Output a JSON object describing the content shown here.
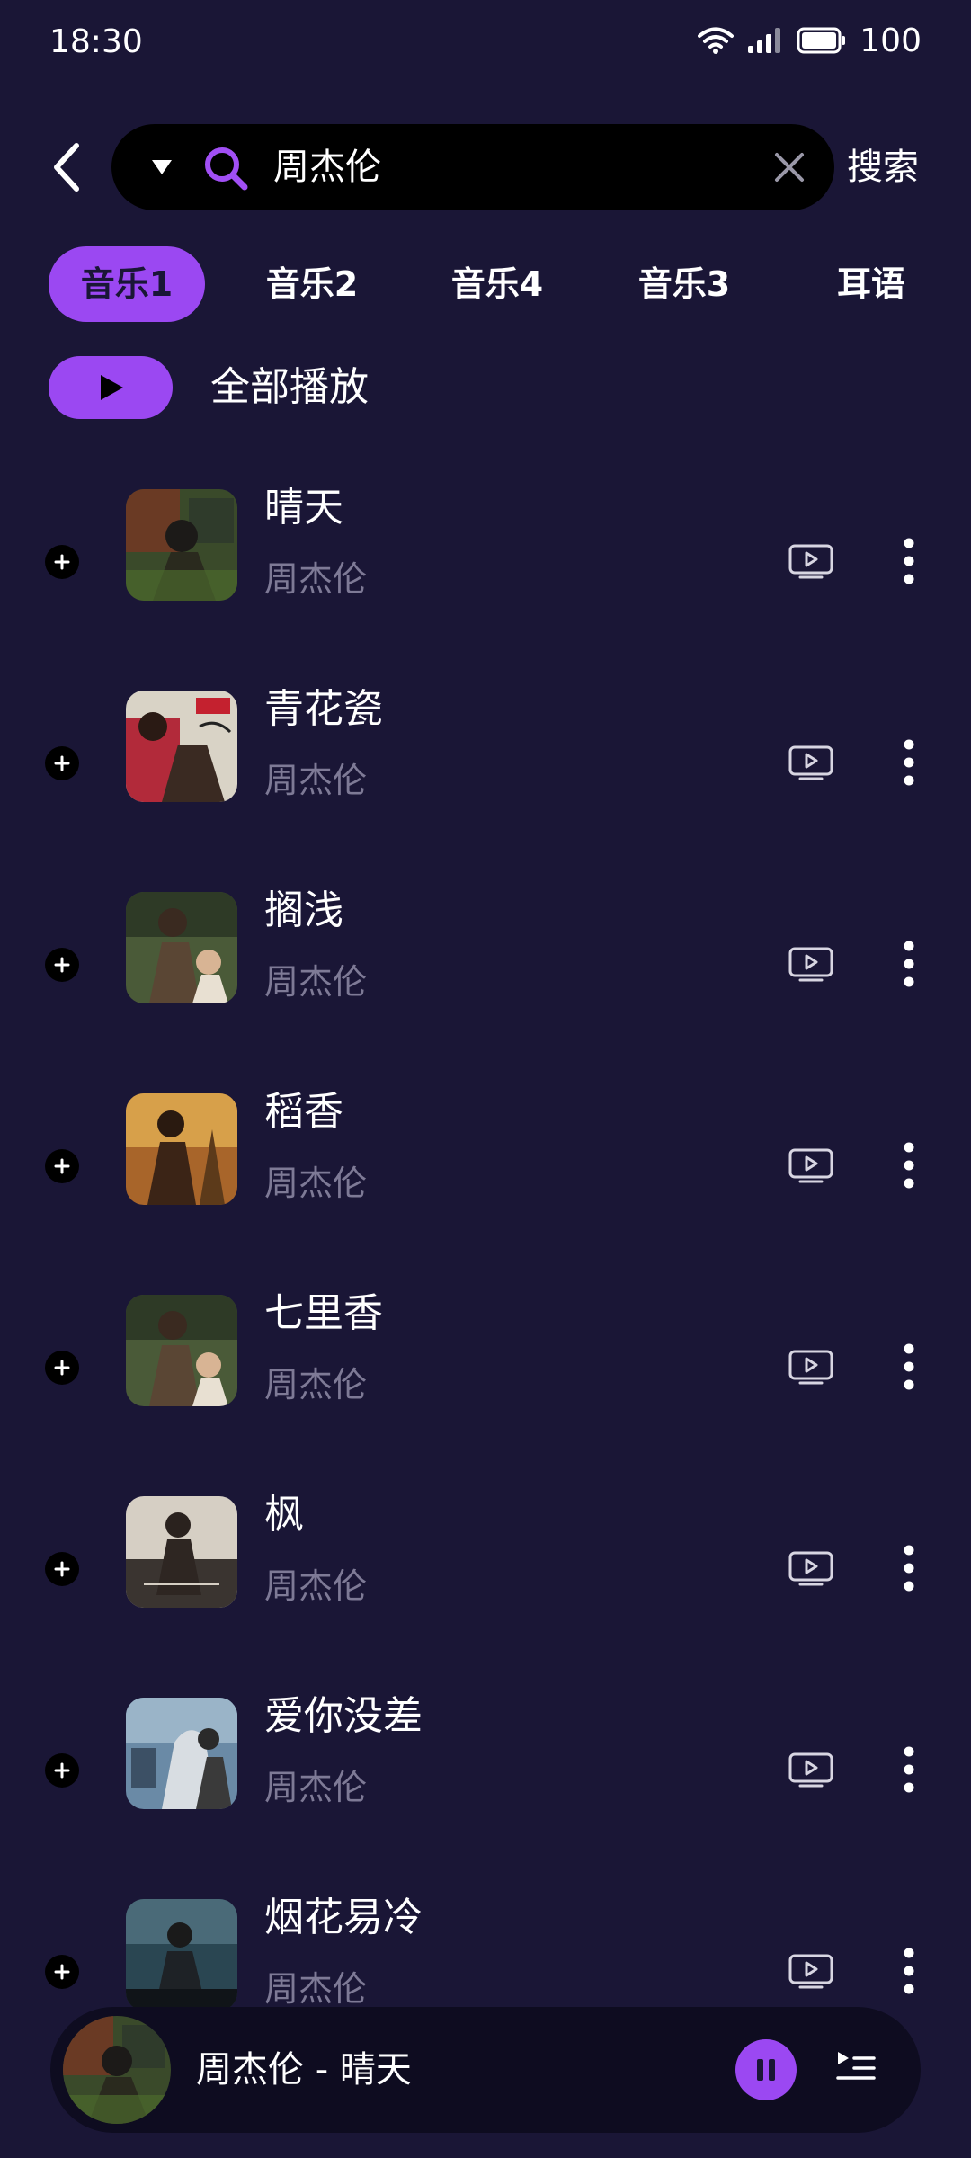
{
  "status": {
    "time": "18:30",
    "battery": "100"
  },
  "search": {
    "query": "周杰伦",
    "button_label": "搜索"
  },
  "tabs": [
    {
      "label": "音乐1",
      "active": true
    },
    {
      "label": "音乐2",
      "active": false
    },
    {
      "label": "音乐4",
      "active": false
    },
    {
      "label": "音乐3",
      "active": false
    },
    {
      "label": "耳语",
      "active": false
    }
  ],
  "play_all": {
    "label": "全部播放"
  },
  "songs": [
    {
      "title": "晴天",
      "artist": "周杰伦"
    },
    {
      "title": "青花瓷",
      "artist": "周杰伦"
    },
    {
      "title": "搁浅",
      "artist": "周杰伦"
    },
    {
      "title": "稻香",
      "artist": "周杰伦"
    },
    {
      "title": "七里香",
      "artist": "周杰伦"
    },
    {
      "title": "枫",
      "artist": "周杰伦"
    },
    {
      "title": "爱你没差",
      "artist": "周杰伦"
    },
    {
      "title": "烟花易冷",
      "artist": "周杰伦"
    }
  ],
  "now_playing": {
    "title": "周杰伦 - 晴天"
  },
  "colors": {
    "background": "#1a1636",
    "accent": "#9b48f2",
    "secondary_text": "#7e7a96"
  }
}
